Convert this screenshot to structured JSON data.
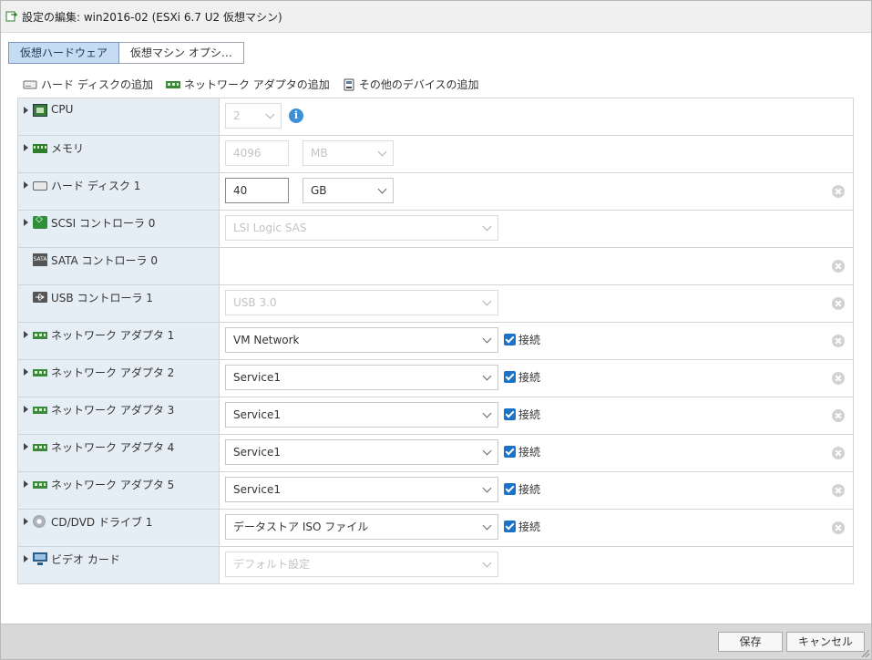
{
  "window": {
    "title": "設定の編集: win2016-02 (ESXi 6.7 U2 仮想マシン)",
    "title_icon": "vm-edit-icon"
  },
  "tabs": [
    {
      "label": "仮想ハードウェア",
      "active": true
    },
    {
      "label": "仮想マシン オプシ…",
      "active": false
    }
  ],
  "add_bar": {
    "add_disk": {
      "label": "ハード ディスクの追加",
      "icon": "hard-disk-icon"
    },
    "add_network": {
      "label": "ネットワーク アダプタの追加",
      "icon": "network-adapter-icon"
    },
    "add_other": {
      "label": "その他のデバイスの追加",
      "icon": "device-icon"
    }
  },
  "devices": {
    "cpu": {
      "label": "CPU",
      "value": "2",
      "info_icon": "i"
    },
    "memory": {
      "label": "メモリ",
      "value": "4096",
      "unit": "MB"
    },
    "hard_disk_1": {
      "label": "ハード ディスク 1",
      "value": "40",
      "unit": "GB"
    },
    "scsi_controller_0": {
      "label": "SCSI コントローラ 0",
      "value": "LSI Logic SAS"
    },
    "sata_controller_0": {
      "label": "SATA コントローラ 0",
      "icon_text": "SATA"
    },
    "usb_controller_1": {
      "label": "USB コントローラ 1",
      "value": "USB 3.0"
    },
    "network_adapter_1": {
      "label": "ネットワーク アダプタ 1",
      "value": "VM Network",
      "connect_label": "接続",
      "connected": true
    },
    "network_adapter_2": {
      "label": "ネットワーク アダプタ 2",
      "value": "Service1",
      "connect_label": "接続",
      "connected": true
    },
    "network_adapter_3": {
      "label": "ネットワーク アダプタ 3",
      "value": "Service1",
      "connect_label": "接続",
      "connected": true
    },
    "network_adapter_4": {
      "label": "ネットワーク アダプタ 4",
      "value": "Service1",
      "connect_label": "接続",
      "connected": true
    },
    "network_adapter_5": {
      "label": "ネットワーク アダプタ 5",
      "value": "Service1",
      "connect_label": "接続",
      "connected": true
    },
    "cd_dvd_drive_1": {
      "label": "CD/DVD ドライブ 1",
      "value": "データストア ISO ファイル",
      "connect_label": "接続",
      "connected": true
    },
    "video_card": {
      "label": "ビデオ カード",
      "value": "デフォルト設定"
    }
  },
  "footer": {
    "save_label": "保存",
    "cancel_label": "キャンセル"
  },
  "colors": {
    "label_bg": "#e6eef5",
    "tab_active_bg": "#c6dcf3",
    "checkbox": "#1a73c9",
    "footer_bg": "#d8d8d8"
  }
}
